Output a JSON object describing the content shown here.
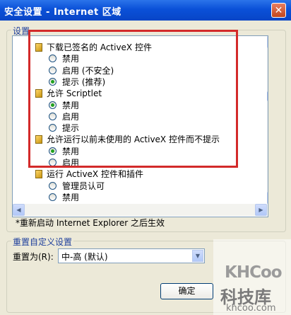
{
  "window": {
    "title": "安全设置 - Internet 区域",
    "close_glyph": "✕"
  },
  "settings_group": {
    "label": "设置",
    "items": [
      {
        "kind": "heading",
        "label": "下载已签名的 ActiveX 控件"
      },
      {
        "kind": "radio",
        "label": "禁用",
        "checked": false
      },
      {
        "kind": "radio",
        "label": "启用 (不安全)",
        "checked": false
      },
      {
        "kind": "radio",
        "label": "提示 (推荐)",
        "checked": true
      },
      {
        "kind": "heading",
        "label": "允许 Scriptlet"
      },
      {
        "kind": "radio",
        "label": "禁用",
        "checked": true
      },
      {
        "kind": "radio",
        "label": "启用",
        "checked": false
      },
      {
        "kind": "radio",
        "label": "提示",
        "checked": false
      },
      {
        "kind": "heading",
        "label": "允许运行以前未使用的 ActiveX 控件而不提示"
      },
      {
        "kind": "radio",
        "label": "禁用",
        "checked": true
      },
      {
        "kind": "radio",
        "label": "启用",
        "checked": false
      },
      {
        "kind": "heading",
        "label": "运行 ActiveX 控件和插件"
      },
      {
        "kind": "radio",
        "label": "管理员认可",
        "checked": false
      },
      {
        "kind": "radio",
        "label": "禁用",
        "checked": false
      },
      {
        "kind": "radio",
        "label": "...",
        "checked": false
      }
    ],
    "note": "*重新启动 Internet Explorer 之后生效"
  },
  "reset_group": {
    "label": "重置自定义设置",
    "reset_to_label": "重置为(R):",
    "reset_value": "中-高 (默认)",
    "reset_button_label": "确定"
  },
  "watermark": {
    "logo": "KHCoo",
    "name": "科技库",
    "url": "khcoo.com"
  },
  "colors": {
    "highlight_box": "#d32a2a",
    "title_bar": "#0a50d8",
    "radio_dot": "#21a121"
  }
}
